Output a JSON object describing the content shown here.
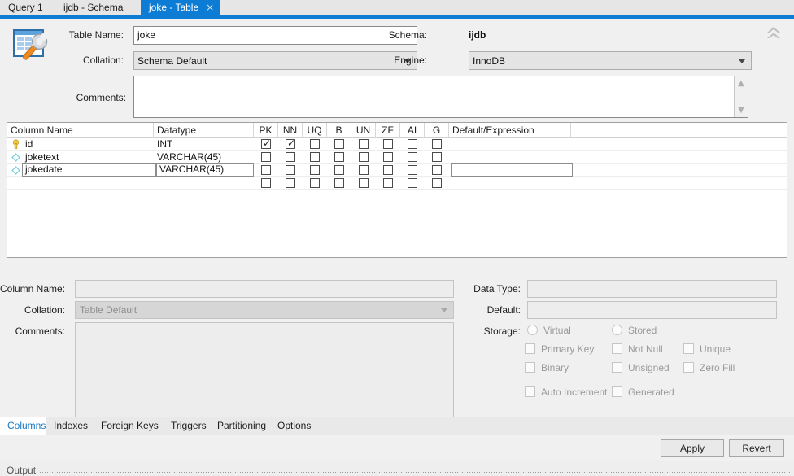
{
  "tabs": [
    {
      "label": "Query 1",
      "active": false,
      "closable": false
    },
    {
      "label": "ijdb - Schema",
      "active": false,
      "closable": false
    },
    {
      "label": "joke - Table",
      "active": true,
      "closable": true,
      "close_glyph": "×"
    }
  ],
  "header": {
    "icon_name": "table-editor-icon",
    "table_name_label": "Table Name:",
    "table_name_value": "joke",
    "collation_label": "Collation:",
    "collation_value": "Schema Default",
    "comments_label": "Comments:",
    "comments_value": "",
    "schema_label": "Schema:",
    "schema_value": "ijdb",
    "engine_label": "Engine:",
    "engine_value": "InnoDB",
    "collapse_icon": "double-chevron-up-icon"
  },
  "grid": {
    "columns": [
      {
        "key": "name",
        "label": "Column Name"
      },
      {
        "key": "datatype",
        "label": "Datatype"
      },
      {
        "key": "pk",
        "label": "PK"
      },
      {
        "key": "nn",
        "label": "NN"
      },
      {
        "key": "uq",
        "label": "UQ"
      },
      {
        "key": "b",
        "label": "B"
      },
      {
        "key": "un",
        "label": "UN"
      },
      {
        "key": "zf",
        "label": "ZF"
      },
      {
        "key": "ai",
        "label": "AI"
      },
      {
        "key": "g",
        "label": "G"
      },
      {
        "key": "default",
        "label": "Default/Expression"
      }
    ],
    "rows": [
      {
        "icon": "primary-key-icon",
        "name": "id",
        "datatype": "INT",
        "pk": true,
        "nn": true,
        "uq": false,
        "b": false,
        "un": false,
        "zf": false,
        "ai": false,
        "g": false,
        "default": "",
        "editing": false,
        "default_editing": false
      },
      {
        "icon": "column-diamond-icon",
        "name": "joketext",
        "datatype": "VARCHAR(45)",
        "pk": false,
        "nn": false,
        "uq": false,
        "b": false,
        "un": false,
        "zf": false,
        "ai": false,
        "g": false,
        "default": "",
        "editing": false,
        "default_editing": false
      },
      {
        "icon": "column-diamond-icon",
        "name": "jokedate",
        "datatype": "VARCHAR(45)",
        "pk": false,
        "nn": false,
        "uq": false,
        "b": false,
        "un": false,
        "zf": false,
        "ai": false,
        "g": false,
        "default": "",
        "editing": true,
        "default_editing": true
      },
      {
        "icon": "",
        "name": "",
        "datatype": "",
        "pk": false,
        "nn": false,
        "uq": false,
        "b": false,
        "un": false,
        "zf": false,
        "ai": false,
        "g": false,
        "default": "",
        "editing": false,
        "default_editing": false
      }
    ]
  },
  "detail": {
    "column_name_label": "Column Name:",
    "column_name_value": "",
    "collation_label": "Collation:",
    "collation_value": "Table Default",
    "comments_label": "Comments:",
    "comments_value": "",
    "data_type_label": "Data Type:",
    "data_type_value": "",
    "default_label": "Default:",
    "default_value": "",
    "storage_label": "Storage:",
    "options": [
      {
        "label": "Virtual",
        "type": "radio",
        "checked": false
      },
      {
        "label": "Stored",
        "type": "radio",
        "checked": false
      },
      {
        "label": "Primary Key",
        "type": "checkbox",
        "checked": false
      },
      {
        "label": "Not Null",
        "type": "checkbox",
        "checked": false
      },
      {
        "label": "Unique",
        "type": "checkbox",
        "checked": false
      },
      {
        "label": "Binary",
        "type": "checkbox",
        "checked": false
      },
      {
        "label": "Unsigned",
        "type": "checkbox",
        "checked": false
      },
      {
        "label": "Zero Fill",
        "type": "checkbox",
        "checked": false
      },
      {
        "label": "Auto Increment",
        "type": "checkbox",
        "checked": false
      },
      {
        "label": "Generated",
        "type": "checkbox",
        "checked": false
      }
    ]
  },
  "bottom_tabs": [
    {
      "label": "Columns",
      "active": true
    },
    {
      "label": "Indexes",
      "active": false
    },
    {
      "label": "Foreign Keys",
      "active": false
    },
    {
      "label": "Triggers",
      "active": false
    },
    {
      "label": "Partitioning",
      "active": false
    },
    {
      "label": "Options",
      "active": false
    }
  ],
  "buttons": {
    "apply": "Apply",
    "revert": "Revert"
  },
  "output": {
    "label": "Output"
  },
  "colors": {
    "accent_blue": "#0c7cd5",
    "active_tab_text": "#1675c0",
    "key_yellow": "#f2c744",
    "diamond_blue": "#7fd0e8",
    "window_bg": "#f0f0f0"
  }
}
